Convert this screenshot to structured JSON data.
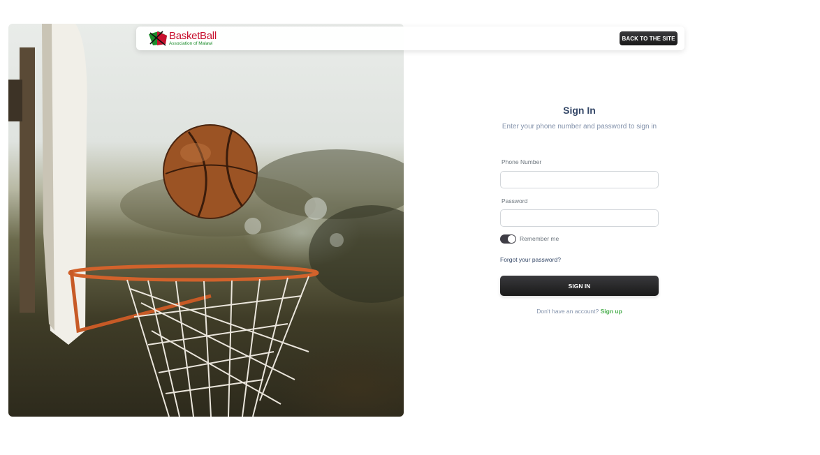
{
  "navbar": {
    "brand_name": "BasketBall",
    "brand_subtitle": "Association of Malawi",
    "back_button": "BACK TO THE SITE"
  },
  "signin": {
    "title": "Sign In",
    "subtitle": "Enter your phone number and password to sign in",
    "phone_label": "Phone Number",
    "phone_value": "",
    "password_label": "Password",
    "password_value": "",
    "remember_label": "Remember me",
    "remember_checked": true,
    "forgot_link": "Forgot your password?",
    "submit_button": "SIGN IN",
    "no_account_text": "Don't have an account?",
    "signup_link": "Sign up"
  },
  "colors": {
    "brand_red": "#c8102e",
    "brand_green": "#1c8c2c",
    "button_dark": "#191919",
    "link_green": "#4caf50"
  },
  "icons": {
    "brand_logo": "basketball-association-logo"
  }
}
